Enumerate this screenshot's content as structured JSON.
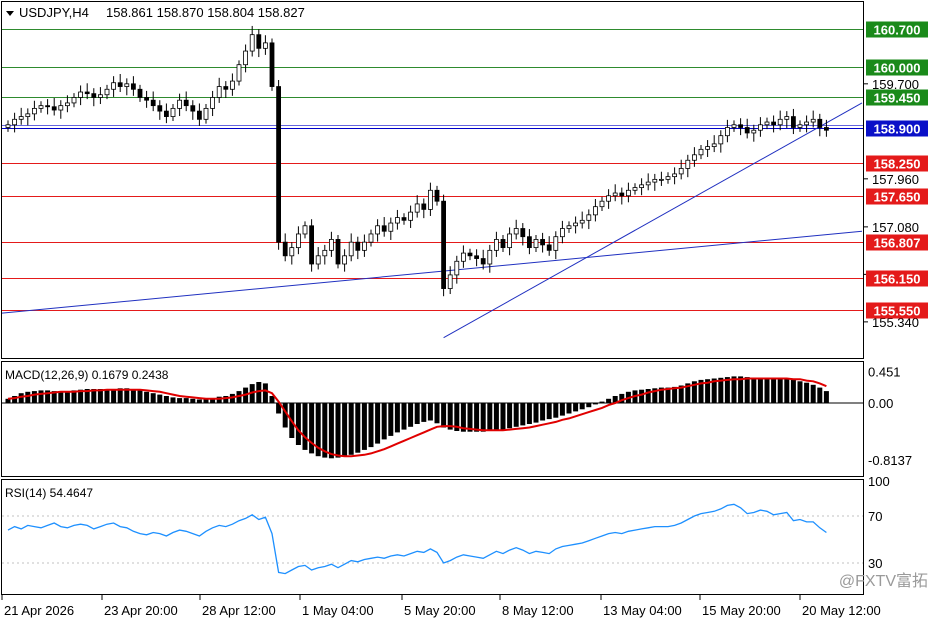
{
  "header": {
    "symbol": "USDJPY,H4",
    "ohlc": "158.861 158.870 158.804 158.827"
  },
  "colors": {
    "background": "#ffffff",
    "frame": "#000000",
    "grid": "#c0c0c0",
    "up_candle": "#2e7d32",
    "down_candle": "#c62828",
    "resistance_line": "#2e8b2e",
    "support_line": "#e41a1a",
    "current_line": "#0000c8",
    "trendline": "#2030c0",
    "macd_signal": "#e00000",
    "rsi_line": "#1e90ff"
  },
  "price_axis": {
    "ticks": [
      "159.700",
      "157.960",
      "157.080",
      "156.210",
      "155.340"
    ]
  },
  "levels": [
    {
      "label": "160.700",
      "value": 160.7,
      "kind": "resistance"
    },
    {
      "label": "160.000",
      "value": 160.0,
      "kind": "resistance"
    },
    {
      "label": "159.450",
      "value": 159.45,
      "kind": "resistance"
    },
    {
      "label": "158.900",
      "value": 158.9,
      "kind": "current"
    },
    {
      "label": "158.250",
      "value": 158.25,
      "kind": "support"
    },
    {
      "label": "157.650",
      "value": 157.65,
      "kind": "support"
    },
    {
      "label": "156.807",
      "value": 156.807,
      "kind": "support"
    },
    {
      "label": "156.150",
      "value": 156.15,
      "kind": "support"
    },
    {
      "label": "155.550",
      "value": 155.55,
      "kind": "support"
    }
  ],
  "time_axis": [
    "21 Apr 2026",
    "23 Apr 20:00",
    "28 Apr 12:00",
    "1 May 04:00",
    "5 May 20:00",
    "8 May 12:00",
    "13 May 04:00",
    "15 May 20:00",
    "20 May 12:00"
  ],
  "macd": {
    "label": "MACD(12,26,9) 0.1679 0.2438",
    "ticks": [
      "0.451",
      "0.00",
      "-0.8137"
    ]
  },
  "rsi": {
    "label": "RSI(14) 54.4647",
    "ticks": [
      "100",
      "70",
      "30"
    ]
  },
  "watermark": "@FXTV富拓",
  "chart_data": [
    {
      "type": "candlestick",
      "title": "USDJPY,H4",
      "ylim": [
        155.0,
        161.0
      ],
      "closes": [
        158.95,
        159.05,
        159.1,
        159.15,
        159.25,
        159.3,
        159.28,
        159.22,
        159.3,
        159.35,
        159.45,
        159.55,
        159.52,
        159.45,
        159.5,
        159.6,
        159.72,
        159.65,
        159.7,
        159.6,
        159.45,
        159.4,
        159.3,
        159.2,
        159.1,
        159.25,
        159.4,
        159.3,
        159.2,
        159.05,
        159.25,
        159.45,
        159.65,
        159.6,
        159.75,
        160.05,
        160.3,
        160.6,
        160.35,
        160.45,
        159.65,
        156.8,
        156.55,
        156.7,
        156.95,
        157.1,
        156.4,
        156.55,
        156.65,
        156.85,
        156.4,
        156.55,
        156.8,
        156.65,
        156.8,
        156.95,
        157.1,
        157.0,
        157.15,
        157.25,
        157.2,
        157.35,
        157.5,
        157.4,
        157.75,
        157.55,
        155.95,
        156.2,
        156.45,
        156.6,
        156.55,
        156.5,
        156.4,
        156.65,
        156.85,
        156.7,
        156.95,
        157.05,
        156.9,
        156.7,
        156.85,
        156.75,
        156.65,
        156.9,
        157.05,
        157.1,
        157.15,
        157.2,
        157.3,
        157.45,
        157.55,
        157.65,
        157.7,
        157.65,
        157.75,
        157.8,
        157.85,
        157.9,
        157.95,
        157.95,
        158.0,
        158.05,
        158.15,
        158.3,
        158.4,
        158.5,
        158.55,
        158.6,
        158.75,
        158.9,
        158.95,
        158.9,
        158.8,
        158.85,
        158.95,
        159.0,
        158.95,
        159.05,
        159.1,
        158.9,
        158.95,
        159.0,
        159.05,
        158.9,
        158.85
      ],
      "support_resistance_levels": [
        160.7,
        160.0,
        159.45,
        158.9,
        158.25,
        157.65,
        156.807,
        156.15,
        155.55
      ]
    },
    {
      "type": "bar",
      "title": "MACD(12,26,9) 0.1679 0.2438",
      "ylim": [
        -0.8137,
        0.451
      ],
      "histogram": [
        0.06,
        0.1,
        0.14,
        0.16,
        0.17,
        0.18,
        0.18,
        0.17,
        0.17,
        0.17,
        0.18,
        0.19,
        0.2,
        0.2,
        0.2,
        0.19,
        0.2,
        0.21,
        0.21,
        0.2,
        0.18,
        0.16,
        0.14,
        0.12,
        0.1,
        0.08,
        0.07,
        0.07,
        0.06,
        0.05,
        0.06,
        0.07,
        0.09,
        0.1,
        0.13,
        0.17,
        0.22,
        0.27,
        0.3,
        0.28,
        0.1,
        -0.15,
        -0.35,
        -0.5,
        -0.6,
        -0.67,
        -0.72,
        -0.76,
        -0.78,
        -0.79,
        -0.78,
        -0.76,
        -0.74,
        -0.71,
        -0.67,
        -0.63,
        -0.58,
        -0.52,
        -0.47,
        -0.42,
        -0.38,
        -0.34,
        -0.3,
        -0.27,
        -0.25,
        -0.29,
        -0.35,
        -0.38,
        -0.4,
        -0.41,
        -0.41,
        -0.41,
        -0.41,
        -0.4,
        -0.39,
        -0.38,
        -0.36,
        -0.34,
        -0.32,
        -0.3,
        -0.28,
        -0.25,
        -0.23,
        -0.21,
        -0.18,
        -0.15,
        -0.12,
        -0.09,
        -0.06,
        -0.02,
        0.02,
        0.06,
        0.1,
        0.13,
        0.16,
        0.18,
        0.19,
        0.2,
        0.21,
        0.22,
        0.22,
        0.23,
        0.25,
        0.28,
        0.31,
        0.33,
        0.34,
        0.35,
        0.36,
        0.37,
        0.38,
        0.38,
        0.37,
        0.36,
        0.36,
        0.36,
        0.35,
        0.34,
        0.34,
        0.33,
        0.31,
        0.29,
        0.26,
        0.22,
        0.17
      ],
      "signal": [
        0.06,
        0.07,
        0.09,
        0.1,
        0.12,
        0.13,
        0.14,
        0.15,
        0.16,
        0.16,
        0.16,
        0.17,
        0.17,
        0.18,
        0.18,
        0.19,
        0.19,
        0.19,
        0.19,
        0.19,
        0.19,
        0.18,
        0.17,
        0.16,
        0.14,
        0.12,
        0.1,
        0.09,
        0.08,
        0.07,
        0.06,
        0.06,
        0.06,
        0.07,
        0.08,
        0.1,
        0.12,
        0.15,
        0.17,
        0.18,
        0.14,
        0.02,
        -0.12,
        -0.26,
        -0.39,
        -0.49,
        -0.57,
        -0.64,
        -0.69,
        -0.73,
        -0.75,
        -0.76,
        -0.76,
        -0.75,
        -0.74,
        -0.72,
        -0.69,
        -0.66,
        -0.62,
        -0.58,
        -0.54,
        -0.5,
        -0.46,
        -0.42,
        -0.38,
        -0.34,
        -0.33,
        -0.33,
        -0.34,
        -0.36,
        -0.37,
        -0.38,
        -0.39,
        -0.39,
        -0.39,
        -0.39,
        -0.38,
        -0.37,
        -0.36,
        -0.35,
        -0.33,
        -0.31,
        -0.29,
        -0.27,
        -0.24,
        -0.22,
        -0.19,
        -0.16,
        -0.13,
        -0.1,
        -0.07,
        -0.03,
        0.0,
        0.04,
        0.07,
        0.1,
        0.12,
        0.15,
        0.17,
        0.19,
        0.2,
        0.21,
        0.22,
        0.24,
        0.26,
        0.28,
        0.29,
        0.31,
        0.32,
        0.33,
        0.34,
        0.34,
        0.35,
        0.35,
        0.35,
        0.35,
        0.35,
        0.35,
        0.35,
        0.34,
        0.34,
        0.32,
        0.31,
        0.28,
        0.24
      ]
    },
    {
      "type": "line",
      "title": "RSI(14) 54.4647",
      "ylim": [
        0,
        100
      ],
      "values": [
        58,
        61,
        59,
        62,
        61,
        60,
        62,
        64,
        61,
        60,
        62,
        63,
        62,
        59,
        61,
        63,
        64,
        61,
        60,
        57,
        55,
        54,
        56,
        55,
        53,
        56,
        58,
        57,
        55,
        53,
        57,
        60,
        62,
        61,
        63,
        66,
        68,
        71,
        67,
        69,
        55,
        22,
        21,
        24,
        27,
        28,
        24,
        26,
        27,
        29,
        26,
        29,
        32,
        31,
        33,
        34,
        35,
        34,
        36,
        37,
        36,
        38,
        40,
        39,
        42,
        39,
        30,
        32,
        35,
        37,
        36,
        35,
        34,
        37,
        40,
        38,
        41,
        43,
        41,
        38,
        40,
        39,
        38,
        42,
        44,
        45,
        46,
        47,
        49,
        51,
        53,
        55,
        56,
        55,
        57,
        58,
        59,
        60,
        61,
        61,
        61,
        62,
        64,
        67,
        70,
        72,
        73,
        74,
        76,
        79,
        80,
        77,
        72,
        73,
        75,
        74,
        71,
        72,
        73,
        66,
        67,
        65,
        65,
        60,
        56
      ]
    }
  ]
}
